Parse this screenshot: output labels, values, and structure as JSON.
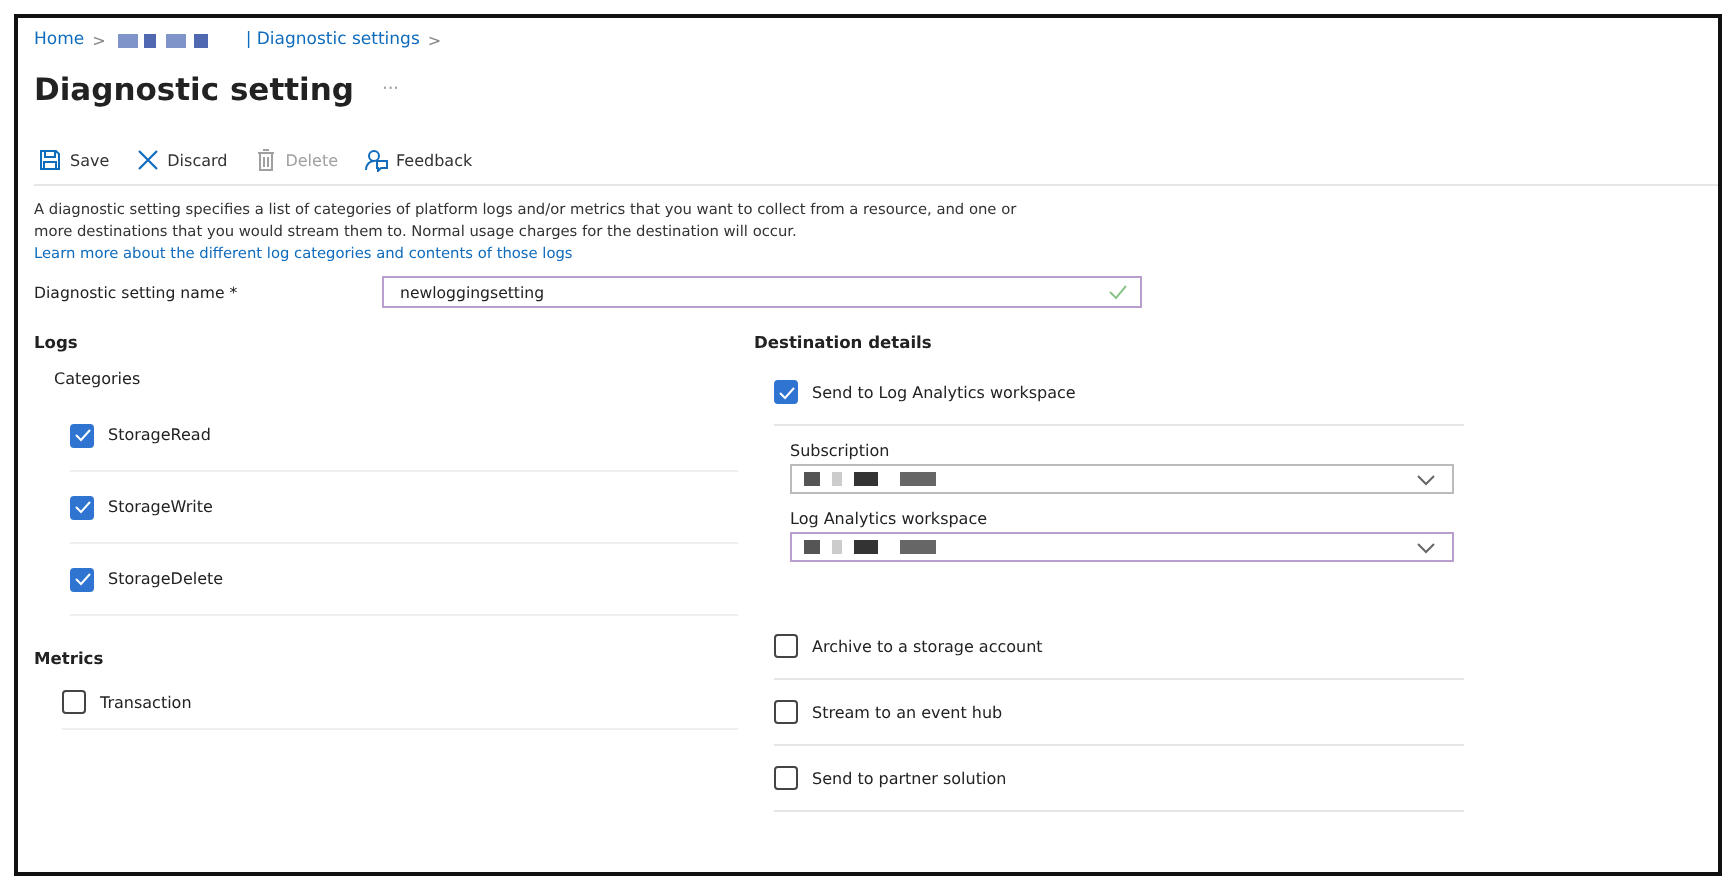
{
  "breadcrumb": [
    {
      "kind": "link",
      "label": "Home"
    },
    {
      "kind": "separator",
      "label": ">"
    },
    {
      "kind": "redacted"
    },
    {
      "kind": "link",
      "label": "| Diagnostic settings"
    },
    {
      "kind": "separator",
      "label": ">"
    }
  ],
  "title": "Diagnostic setting",
  "title_more": "···",
  "toolbar": [
    {
      "kind": "save",
      "label": "Save",
      "disabled": false
    },
    {
      "kind": "discard",
      "label": "Discard",
      "disabled": false
    },
    {
      "kind": "delete",
      "label": "Delete",
      "disabled": true
    },
    {
      "kind": "feedback",
      "label": "Feedback",
      "disabled": false
    }
  ],
  "description": {
    "text": "A diagnostic setting specifies a list of categories of platform logs and/or metrics that you want to collect from a resource, and one or more destinations that you would stream them to. Normal usage charges for the destination will occur.",
    "link": "Learn more about the different log categories and contents of those logs"
  },
  "name_field": {
    "label": "Diagnostic setting name *",
    "value": "newloggingsetting",
    "valid": true
  },
  "logs": {
    "title": "Logs",
    "subtitle": "Categories",
    "items": [
      {
        "label": "StorageRead",
        "checked": true
      },
      {
        "label": "StorageWrite",
        "checked": true
      },
      {
        "label": "StorageDelete",
        "checked": true
      }
    ]
  },
  "metrics": {
    "title": "Metrics",
    "items": [
      {
        "label": "Transaction",
        "checked": false
      }
    ]
  },
  "destination": {
    "title": "Destination details",
    "options": [
      {
        "label": "Send to Log Analytics workspace",
        "checked": true,
        "fields": [
          {
            "label": "Subscription",
            "focused": false
          },
          {
            "label": "Log Analytics workspace",
            "focused": true
          }
        ]
      },
      {
        "label": "Archive to a storage account",
        "checked": false
      },
      {
        "label": "Stream to an event hub",
        "checked": false
      },
      {
        "label": "Send to partner solution",
        "checked": false
      }
    ]
  }
}
